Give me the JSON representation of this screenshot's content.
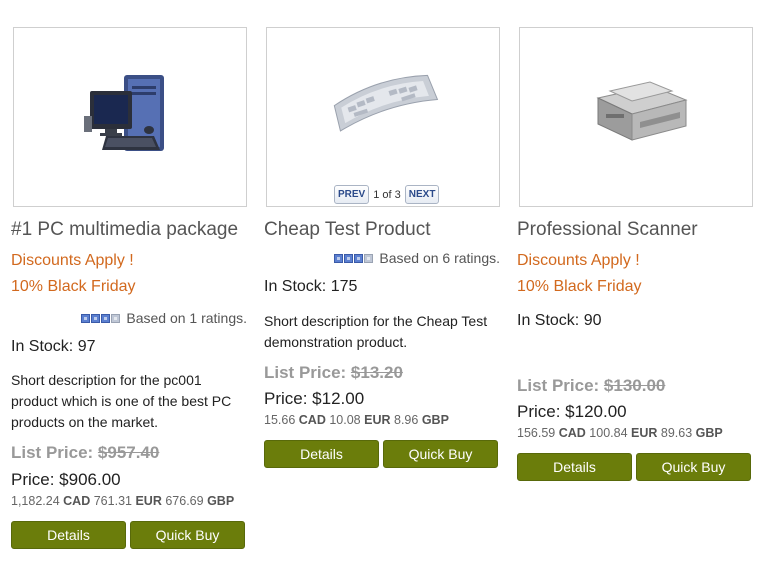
{
  "products": [
    {
      "title": "#1 PC multimedia package",
      "promos": [
        "Discounts Apply !",
        "10% Black Friday"
      ],
      "rating_text": "Based on 1 ratings.",
      "rating_stars": 4,
      "stock": "In Stock: 97",
      "description": "Short description for the pc001 product which is one of the best PC products on the market.",
      "list_label": "List Price: ",
      "list_price": "$957.40",
      "price": "Price: $906.00",
      "currencies": [
        {
          "amount": "1,182.24",
          "code": "CAD"
        },
        {
          "amount": "761.31",
          "code": "EUR"
        },
        {
          "amount": "676.69",
          "code": "GBP"
        }
      ],
      "details_label": "Details",
      "quickbuy_label": "Quick Buy",
      "image_icon": "desktop-pc-icon"
    },
    {
      "title": "Cheap Test Product",
      "rating_text": "Based on 6 ratings.",
      "rating_stars": 3,
      "stock": "In Stock: 175",
      "description": "Short description for the Cheap Test demonstration product.",
      "list_label": "List Price: ",
      "list_price": "$13.20",
      "price": "Price: $12.00",
      "currencies": [
        {
          "amount": "15.66",
          "code": "CAD"
        },
        {
          "amount": "10.08",
          "code": "EUR"
        },
        {
          "amount": "8.96",
          "code": "GBP"
        }
      ],
      "details_label": "Details",
      "quickbuy_label": "Quick Buy",
      "image_icon": "keyboard-icon",
      "pager": {
        "prev": "PREV",
        "status": "1 of 3",
        "next": "NEXT"
      }
    },
    {
      "title": "Professional Scanner",
      "promos": [
        "Discounts Apply !",
        "10% Black Friday"
      ],
      "stock": "In Stock: 90",
      "list_label": "List Price: ",
      "list_price": "$130.00",
      "price": "Price: $120.00",
      "currencies": [
        {
          "amount": "156.59",
          "code": "CAD"
        },
        {
          "amount": "100.84",
          "code": "EUR"
        },
        {
          "amount": "89.63",
          "code": "GBP"
        }
      ],
      "details_label": "Details",
      "quickbuy_label": "Quick Buy",
      "image_icon": "scanner-printer-icon"
    }
  ],
  "colors": {
    "promo": "#d2691e",
    "button": "#6b7d0b",
    "list_price": "#999999"
  }
}
